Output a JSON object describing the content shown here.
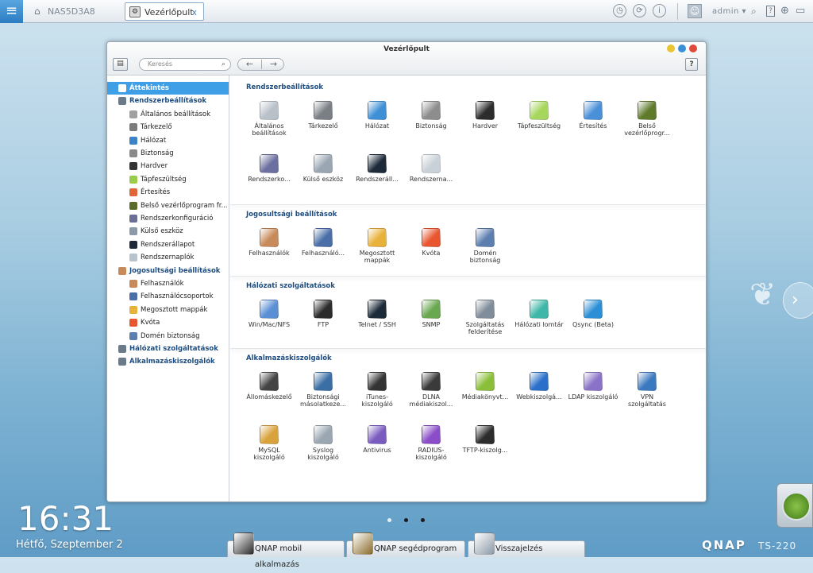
{
  "topbar": {
    "menu_icon": "hamburger-icon",
    "home_tab": "NAS5D3A8",
    "app_tab": "Vezérlőpult",
    "close": "x",
    "user": "admin ▾"
  },
  "window": {
    "title": "Vezérlőpult",
    "search_placeholder": "Keresés",
    "back": "←",
    "forward": "→",
    "help": "?"
  },
  "sidebar": [
    {
      "label": "Áttekintés",
      "kind": "top",
      "active": true,
      "color": "#3f9fe6"
    },
    {
      "label": "Rendszerbeállítások",
      "kind": "top",
      "color": "#6b7a88"
    },
    {
      "label": "Általános beállítások",
      "kind": "sub",
      "color": "#a0a0a0"
    },
    {
      "label": "Tárkezelő",
      "kind": "sub",
      "color": "#7c7c7c"
    },
    {
      "label": "Hálózat",
      "kind": "sub",
      "color": "#3b82c6"
    },
    {
      "label": "Biztonság",
      "kind": "sub",
      "color": "#8a8a8a"
    },
    {
      "label": "Hardver",
      "kind": "sub",
      "color": "#333333"
    },
    {
      "label": "Tápfeszültség",
      "kind": "sub",
      "color": "#9bcb4a"
    },
    {
      "label": "Értesítés",
      "kind": "sub",
      "color": "#e0663a"
    },
    {
      "label": "Belső vezérlőprogram fr...",
      "kind": "sub",
      "color": "#5a6b2a"
    },
    {
      "label": "Rendszerkonfiguráció",
      "kind": "sub",
      "color": "#6b6f95"
    },
    {
      "label": "Külső eszköz",
      "kind": "sub",
      "color": "#8c9aa8"
    },
    {
      "label": "Rendszerállapot",
      "kind": "sub",
      "color": "#1e2a38"
    },
    {
      "label": "Rendszernaplók",
      "kind": "sub",
      "color": "#b9c3cc"
    },
    {
      "label": "Jogosultsági beállítások",
      "kind": "top",
      "color": "#c98a5a"
    },
    {
      "label": "Felhasználók",
      "kind": "sub",
      "color": "#c98a5a"
    },
    {
      "label": "Felhasználócsoportok",
      "kind": "sub",
      "color": "#4a6fa8"
    },
    {
      "label": "Megosztott mappák",
      "kind": "sub",
      "color": "#e8b13a"
    },
    {
      "label": "Kvóta",
      "kind": "sub",
      "color": "#e8552e"
    },
    {
      "label": "Domén biztonság",
      "kind": "sub",
      "color": "#5d7fb0"
    },
    {
      "label": "Hálózati szolgáltatások",
      "kind": "top",
      "color": "#6b7a88"
    },
    {
      "label": "Alkalmazáskiszolgálók",
      "kind": "top",
      "color": "#6b7a88"
    }
  ],
  "sections": [
    {
      "title": "Rendszerbeállítások",
      "items": [
        {
          "label": "Általános beállítások",
          "color": "#b8c0c8"
        },
        {
          "label": "Tárkezelő",
          "color": "#7a7f85"
        },
        {
          "label": "Hálózat",
          "color": "#3d8fd6"
        },
        {
          "label": "Biztonság",
          "color": "#8d8d8d"
        },
        {
          "label": "Hardver",
          "color": "#2c2c2c"
        },
        {
          "label": "Tápfeszültség",
          "color": "#a6d65b"
        },
        {
          "label": "Értesítés",
          "color": "#4a90d9"
        },
        {
          "label": "Belső vezérlőprogr...",
          "color": "#5e7a2a"
        },
        {
          "label": "Rendszerko...",
          "color": "#6c70a0"
        },
        {
          "label": "Külső eszköz",
          "color": "#9aa6b2"
        },
        {
          "label": "Rendszeráll...",
          "color": "#1c2a3a"
        },
        {
          "label": "Rendszerna...",
          "color": "#c9d1d8"
        }
      ]
    },
    {
      "title": "Jogosultsági beállítások",
      "items": [
        {
          "label": "Felhasználók",
          "color": "#c98a5a"
        },
        {
          "label": "Felhasználó...",
          "color": "#4a6fa8"
        },
        {
          "label": "Megosztott mappák",
          "color": "#e8b13a"
        },
        {
          "label": "Kvóta",
          "color": "#e8552e"
        },
        {
          "label": "Domén biztonság",
          "color": "#5d7fb0"
        }
      ]
    },
    {
      "title": "Hálózati szolgáltatások",
      "items": [
        {
          "label": "Win/Mac/NFS",
          "color": "#5a8fd6"
        },
        {
          "label": "FTP",
          "color": "#2c2c2c"
        },
        {
          "label": "Telnet / SSH",
          "color": "#1c2a3a"
        },
        {
          "label": "SNMP",
          "color": "#6aa84f"
        },
        {
          "label": "Szolgáltatás felderítése",
          "color": "#7f8c99"
        },
        {
          "label": "Hálózati lomtár",
          "color": "#3fb7a8"
        },
        {
          "label": "Qsync (Beta)",
          "color": "#2a8fd6"
        }
      ]
    },
    {
      "title": "Alkalmazáskiszolgálók",
      "items": [
        {
          "label": "Állomáskezelő",
          "color": "#444444"
        },
        {
          "label": "Biztonsági másolatkeze...",
          "color": "#3a6ea5"
        },
        {
          "label": "iTunes-kiszolgáló",
          "color": "#333333"
        },
        {
          "label": "DLNA médiakiszol...",
          "color": "#3a3a3a"
        },
        {
          "label": "Médiakönyvt...",
          "color": "#8bbf3a"
        },
        {
          "label": "Webkiszolgá...",
          "color": "#2a6fc9"
        },
        {
          "label": "LDAP kiszolgáló",
          "color": "#8a72c8"
        },
        {
          "label": "VPN szolgáltatás",
          "color": "#3a78c0"
        },
        {
          "label": "MySQL kiszolgáló",
          "color": "#d9a23a"
        },
        {
          "label": "Syslog kiszolgáló",
          "color": "#9aa6b2"
        },
        {
          "label": "Antivirus",
          "color": "#7a5cc0"
        },
        {
          "label": "RADIUS-kiszolgáló",
          "color": "#8a4cc8"
        },
        {
          "label": "TFTP-kiszolg...",
          "color": "#2c2c2c"
        }
      ]
    }
  ],
  "desktop": {
    "time": "16:31",
    "date": "Hétfő, Szeptember 2",
    "dock": [
      {
        "label": "QNAP mobil alkalmazás",
        "icon": "mobile-app-icon",
        "color": "#2b2b2b"
      },
      {
        "label": "QNAP segédprogram",
        "icon": "utility-icon",
        "color": "#8a6b2a"
      },
      {
        "label": "Visszajelzés",
        "icon": "feedback-icon",
        "color": "#8c9aa8"
      }
    ],
    "brand": "QNAP",
    "model": "TS-220",
    "next": "›"
  }
}
